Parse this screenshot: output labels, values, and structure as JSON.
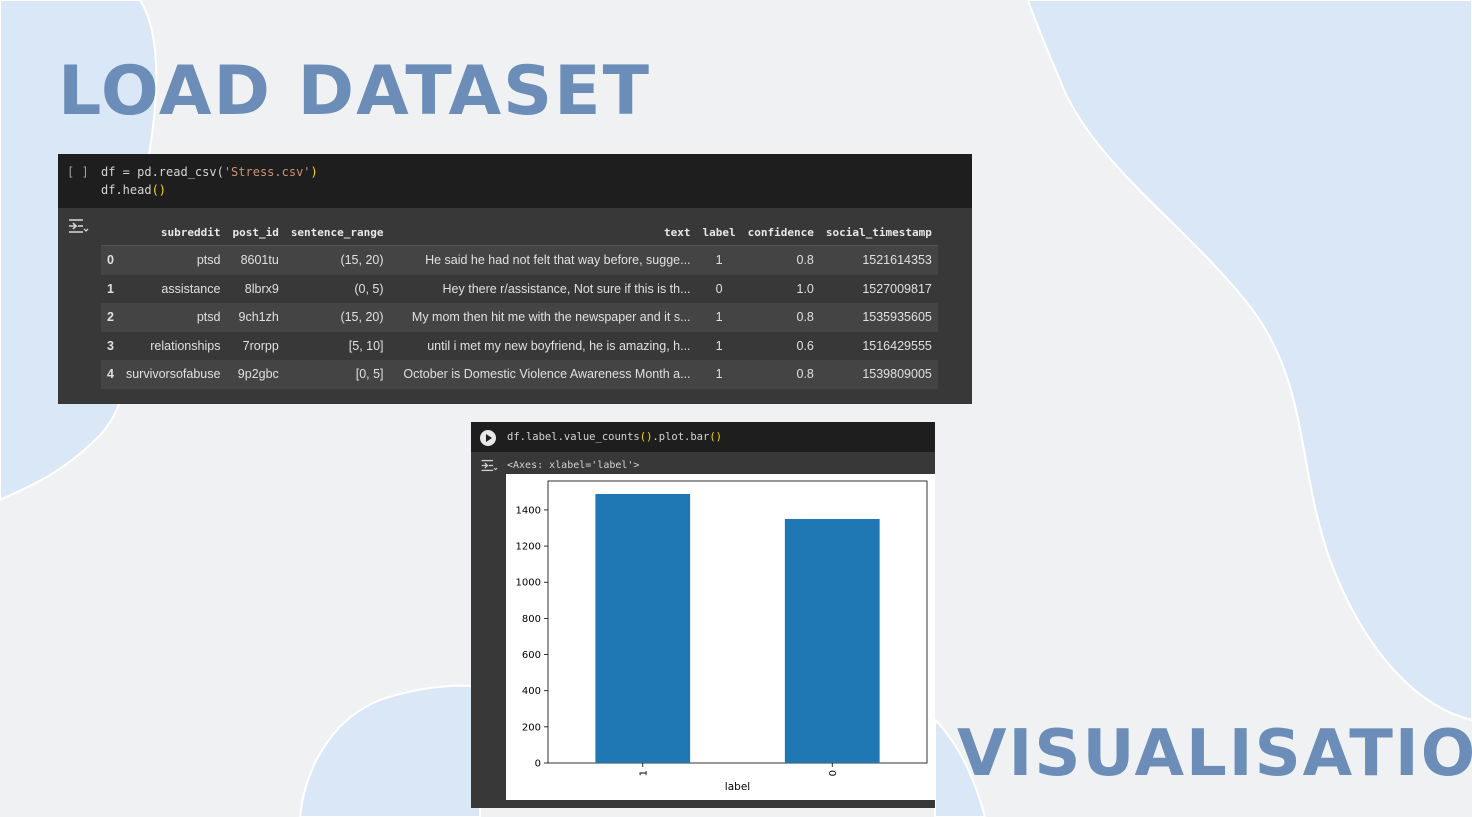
{
  "slide": {
    "title_top": "LOAD DATASET",
    "title_bottom": "VISUALISATION"
  },
  "cell1": {
    "run_label": "[ ]",
    "code_line1": {
      "a": "df = pd.read_csv(",
      "b": "'Stress.csv'",
      "c": ")"
    },
    "code_line2": {
      "a": "df.head",
      "b": "()"
    },
    "table": {
      "columns": [
        "",
        "subreddit",
        "post_id",
        "sentence_range",
        "text",
        "label",
        "confidence",
        "social_timestamp"
      ],
      "rows": [
        [
          "0",
          "ptsd",
          "8601tu",
          "(15, 20)",
          "He said he had not felt that way before, sugge...",
          "1",
          "0.8",
          "1521614353"
        ],
        [
          "1",
          "assistance",
          "8lbrx9",
          "(0, 5)",
          "Hey there r/assistance, Not sure if this is th...",
          "0",
          "1.0",
          "1527009817"
        ],
        [
          "2",
          "ptsd",
          "9ch1zh",
          "(15, 20)",
          "My mom then hit me with the newspaper and it s...",
          "1",
          "0.8",
          "1535935605"
        ],
        [
          "3",
          "relationships",
          "7rorpp",
          "[5, 10]",
          "until i met my new boyfriend, he is amazing, h...",
          "1",
          "0.6",
          "1516429555"
        ],
        [
          "4",
          "survivorsofabuse",
          "9p2gbc",
          "[0, 5]",
          "October is Domestic Violence Awareness Month a...",
          "1",
          "0.8",
          "1539809005"
        ]
      ]
    }
  },
  "cell2": {
    "code": {
      "a": "df.label.value_counts",
      "b": "()",
      "c": ".plot.bar",
      "d": "()"
    },
    "axes_repr": "<Axes: xlabel='label'>"
  },
  "chart_data": {
    "type": "bar",
    "categories": [
      "1",
      "0"
    ],
    "values": [
      1488,
      1350
    ],
    "title": "",
    "xlabel": "label",
    "ylabel": "",
    "ylim": [
      0,
      1560
    ],
    "yticks": [
      0,
      200,
      400,
      600,
      800,
      1000,
      1200,
      1400
    ],
    "bar_color": "#1f77b4",
    "grid": false,
    "xtick_rotation": 90
  }
}
